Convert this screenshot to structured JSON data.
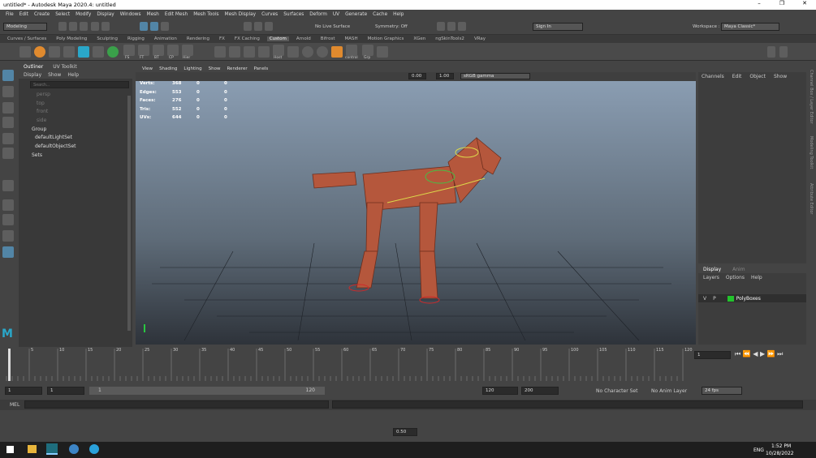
{
  "window": {
    "title": "untitled* - Autodesk Maya 2020.4: untitled",
    "controls": [
      "–",
      "❐",
      "✕"
    ]
  },
  "menus": [
    "File",
    "Edit",
    "Create",
    "Select",
    "Modify",
    "Display",
    "Windows",
    "Mesh",
    "Edit Mesh",
    "Mesh Tools",
    "Mesh Display",
    "Curves",
    "Surfaces",
    "Deform",
    "UV",
    "Generate",
    "Cache",
    "Help"
  ],
  "status": {
    "mode": "Modeling",
    "live_surface": "No Live Surface",
    "symmetry": "Symmetry: Off",
    "sign_in": "Sign In",
    "workspace_label": "Workspace :",
    "workspace": "Maya Classic*"
  },
  "shelf_tabs": [
    "Curves / Surfaces",
    "Poly Modeling",
    "Sculpting",
    "Rigging",
    "Animation",
    "Rendering",
    "FX",
    "FX Caching",
    "Custom",
    "Arnold",
    "Bifrost",
    "MASH",
    "Motion Graphics",
    "XGen",
    "ngSkinTools2",
    "VRay"
  ],
  "active_shelf": "Custom",
  "shelf_labels": [
    "FS",
    "FT",
    "BT",
    "CP",
    "Hier",
    "Host",
    "control",
    "Grp"
  ],
  "outliner": {
    "tabs": [
      "Outliner",
      "UV Toolkit"
    ],
    "menus": [
      "Display",
      "Show",
      "Help"
    ],
    "search_placeholder": "Search...",
    "items": [
      "persp",
      "top",
      "front",
      "side",
      "Group",
      "defaultLightSet",
      "defaultObjectSet",
      "Sets"
    ]
  },
  "viewport": {
    "menus": [
      "View",
      "Shading",
      "Lighting",
      "Show",
      "Renderer",
      "Panels"
    ],
    "exposure": "0.00",
    "gamma": "1.00",
    "colorspace": "sRGB gamma"
  },
  "hud": [
    {
      "label": "Verts:",
      "a": "368",
      "b": "0",
      "c": "0"
    },
    {
      "label": "Edges:",
      "a": "553",
      "b": "0",
      "c": "0"
    },
    {
      "label": "Faces:",
      "a": "276",
      "b": "0",
      "c": "0"
    },
    {
      "label": "Tris:",
      "a": "552",
      "b": "0",
      "c": "0"
    },
    {
      "label": "UVs:",
      "a": "644",
      "b": "0",
      "c": "0"
    }
  ],
  "channel_box": {
    "menus": [
      "Channels",
      "Edit",
      "Object",
      "Show"
    ],
    "side_tabs": [
      "Channel Box / Layer Editor",
      "Modeling Toolkit",
      "Attribute Editor"
    ]
  },
  "layer_editor": {
    "tabs": [
      "Display",
      "Anim"
    ],
    "menus": [
      "Layers",
      "Options",
      "Help"
    ],
    "layer": {
      "v": "V",
      "p": "P",
      "name": "PolyBoxes",
      "color": "#22c32c"
    }
  },
  "timeline": {
    "ticks": [
      "5",
      "10",
      "15",
      "20",
      "25",
      "30",
      "35",
      "40",
      "45",
      "50",
      "55",
      "60",
      "65",
      "70",
      "75",
      "80",
      "85",
      "90",
      "95",
      "100",
      "105",
      "110",
      "115",
      "120"
    ],
    "current_frame": "1"
  },
  "range": {
    "start": "1",
    "start2": "1",
    "slider_start": "1",
    "slider_end": "120",
    "end": "120",
    "end2": "200",
    "character_set": "No Character Set",
    "anim_layer": "No Anim Layer",
    "fps": "24 fps"
  },
  "mel_label": "MEL",
  "bottom": {
    "value": "0.50"
  },
  "taskbar": {
    "time": "1:52 PM",
    "date": "10/28/2022",
    "lang": "ENG"
  },
  "colors": {
    "accent": "#5285a6",
    "model": "#b5573c"
  }
}
